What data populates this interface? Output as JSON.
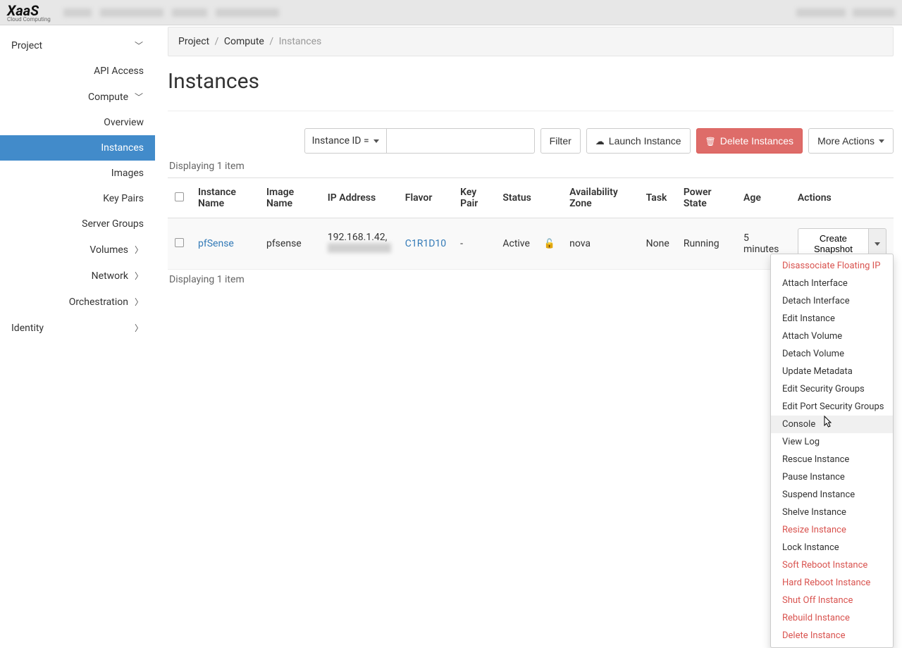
{
  "logo": {
    "main": "XaaS",
    "sub": "Cloud Computing"
  },
  "sidebar": {
    "project": "Project",
    "api_access": "API Access",
    "compute": "Compute",
    "overview": "Overview",
    "instances": "Instances",
    "images": "Images",
    "key_pairs": "Key Pairs",
    "server_groups": "Server Groups",
    "volumes": "Volumes",
    "network": "Network",
    "orchestration": "Orchestration",
    "identity": "Identity"
  },
  "breadcrumb": {
    "project": "Project",
    "compute": "Compute",
    "instances": "Instances"
  },
  "page_title": "Instances",
  "toolbar": {
    "filter_type": "Instance ID =",
    "filter_placeholder": "",
    "filter_btn": "Filter",
    "launch_btn": "Launch Instance",
    "delete_btn": "Delete Instances",
    "more_actions": "More Actions"
  },
  "count_text_top": "Displaying 1 item",
  "count_text_bottom": "Displaying 1 item",
  "columns": {
    "instance_name": "Instance Name",
    "image_name": "Image Name",
    "ip_address": "IP Address",
    "flavor": "Flavor",
    "key_pair": "Key Pair",
    "status": "Status",
    "availability_zone": "Availability Zone",
    "task": "Task",
    "power_state": "Power State",
    "age": "Age",
    "actions": "Actions"
  },
  "row": {
    "instance_name": "pfSense",
    "image_name": "pfsense",
    "ip1": "192.168.1.42,",
    "flavor": "C1R1D10",
    "key_pair": "-",
    "status": "Active",
    "availability_zone": "nova",
    "task": "None",
    "power_state": "Running",
    "age": "5 minutes",
    "action_primary": "Create Snapshot"
  },
  "dropdown": [
    {
      "label": "Disassociate Floating IP",
      "danger": true
    },
    {
      "label": "Attach Interface"
    },
    {
      "label": "Detach Interface"
    },
    {
      "label": "Edit Instance"
    },
    {
      "label": "Attach Volume"
    },
    {
      "label": "Detach Volume"
    },
    {
      "label": "Update Metadata"
    },
    {
      "label": "Edit Security Groups"
    },
    {
      "label": "Edit Port Security Groups"
    },
    {
      "label": "Console",
      "highlight": true
    },
    {
      "label": "View Log"
    },
    {
      "label": "Rescue Instance"
    },
    {
      "label": "Pause Instance"
    },
    {
      "label": "Suspend Instance"
    },
    {
      "label": "Shelve Instance"
    },
    {
      "label": "Resize Instance",
      "danger": true
    },
    {
      "label": "Lock Instance"
    },
    {
      "label": "Soft Reboot Instance",
      "danger": true
    },
    {
      "label": "Hard Reboot Instance",
      "danger": true
    },
    {
      "label": "Shut Off Instance",
      "danger": true
    },
    {
      "label": "Rebuild Instance",
      "danger": true
    },
    {
      "label": "Delete Instance",
      "danger": true
    }
  ]
}
